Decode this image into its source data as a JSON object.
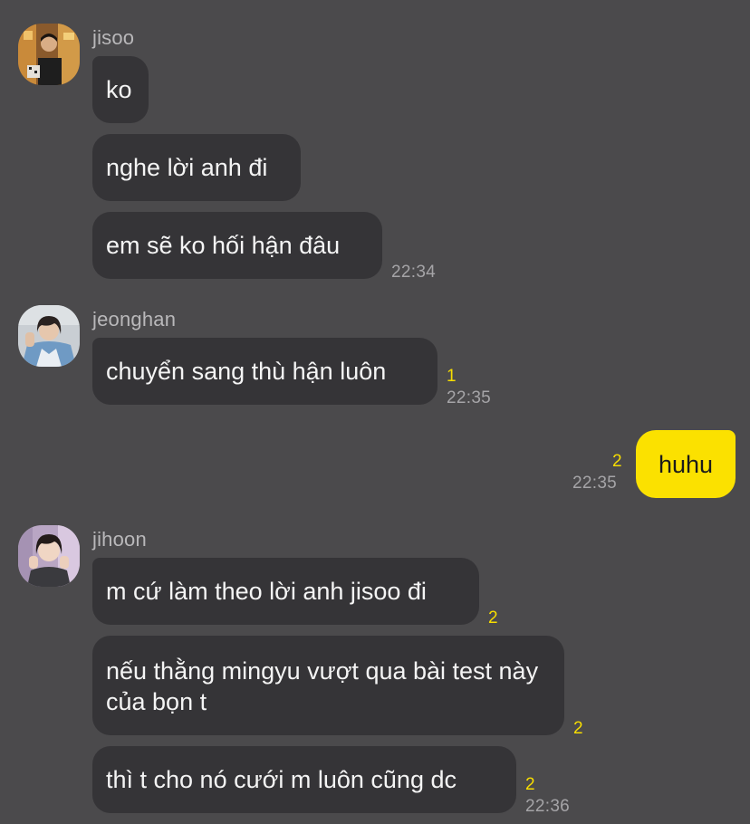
{
  "groups": [
    {
      "sender": "jisoo",
      "messages": [
        {
          "text": "ko"
        },
        {
          "text": "nghe lời anh đi"
        },
        {
          "text": "em sẽ ko hối hận đâu",
          "time": "22:34"
        }
      ]
    },
    {
      "sender": "jeonghan",
      "messages": [
        {
          "text": "chuyển sang thù hận luôn",
          "unread": "1",
          "time": "22:35"
        }
      ]
    },
    {
      "sender": "me",
      "messages": [
        {
          "text": "huhu",
          "unread": "2",
          "time": "22:35"
        }
      ]
    },
    {
      "sender": "jihoon",
      "messages": [
        {
          "text": "m cứ làm theo lời anh jisoo đi",
          "unread": "2"
        },
        {
          "text": "nếu thằng mingyu vượt qua bài test này của bọn t",
          "unread": "2"
        },
        {
          "text": "thì t cho nó cưới m luôn cũng dc",
          "unread": "2",
          "time": "22:36"
        }
      ]
    }
  ],
  "colors": {
    "background": "#4b4a4c",
    "incoming_bubble": "#353437",
    "outgoing_bubble": "#fbe100",
    "unread_count": "#f7dd00"
  }
}
